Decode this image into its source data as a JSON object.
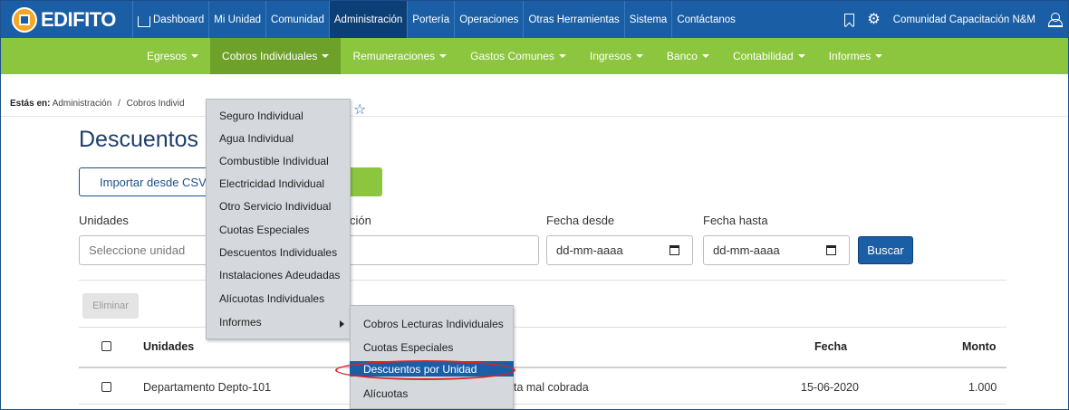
{
  "logo": {
    "text": "EDIFITO"
  },
  "topnav": {
    "items": [
      "Dashboard",
      "Mi Unidad",
      "Comunidad",
      "Administración",
      "Portería",
      "Operaciones",
      "Otras Herramientas",
      "Sistema",
      "Contáctanos"
    ],
    "active_index": 3,
    "community": "Comunidad Capacitación N&M"
  },
  "subnav": {
    "items": [
      "Egresos",
      "Cobros Individuales",
      "Remuneraciones",
      "Gastos Comunes",
      "Ingresos",
      "Banco",
      "Contabilidad",
      "Informes"
    ],
    "active_index": 1
  },
  "breadcrumb": {
    "prefix": "Estás en:",
    "level1": "Administración",
    "sep": "/",
    "level2": "Cobros Individ"
  },
  "page": {
    "title": "Descuentos"
  },
  "actions": {
    "import_csv": "Importar desde CSV",
    "delete": "Eliminar",
    "search": "Buscar"
  },
  "filters": {
    "unidades_label": "Unidades",
    "unidades_placeholder": "Seleccione unidad",
    "descripcion_label_partial": "ción",
    "fecha_desde_label": "Fecha desde",
    "fecha_hasta_label": "Fecha hasta",
    "date_placeholder": "dd-mm-aaaa"
  },
  "table": {
    "headers": {
      "unidades": "Unidades",
      "fecha": "Fecha",
      "monto": "Monto"
    },
    "rows": [
      {
        "unidad": "Departamento Depto-101",
        "descripcion_partial": "ta mal cobrada",
        "fecha": "15-06-2020",
        "monto": "1.000"
      }
    ]
  },
  "dropdown_menu": {
    "items": [
      "Seguro Individual",
      "Agua Individual",
      "Combustible Individual",
      "Electricidad Individual",
      "Otro Servicio Individual",
      "Cuotas Especiales",
      "Descuentos Individuales",
      "Instalaciones Adeudadas",
      "Alícuotas Individuales",
      "Informes"
    ]
  },
  "submenu": {
    "items": [
      "Cobros Lecturas Individuales",
      "Cuotas Especiales",
      "Descuentos por Unidad",
      "Alícuotas"
    ],
    "highlighted_index": 2
  },
  "colors": {
    "primary": "#1a5fa6",
    "green": "#8cc63f",
    "highlight_ring": "#e02020"
  }
}
